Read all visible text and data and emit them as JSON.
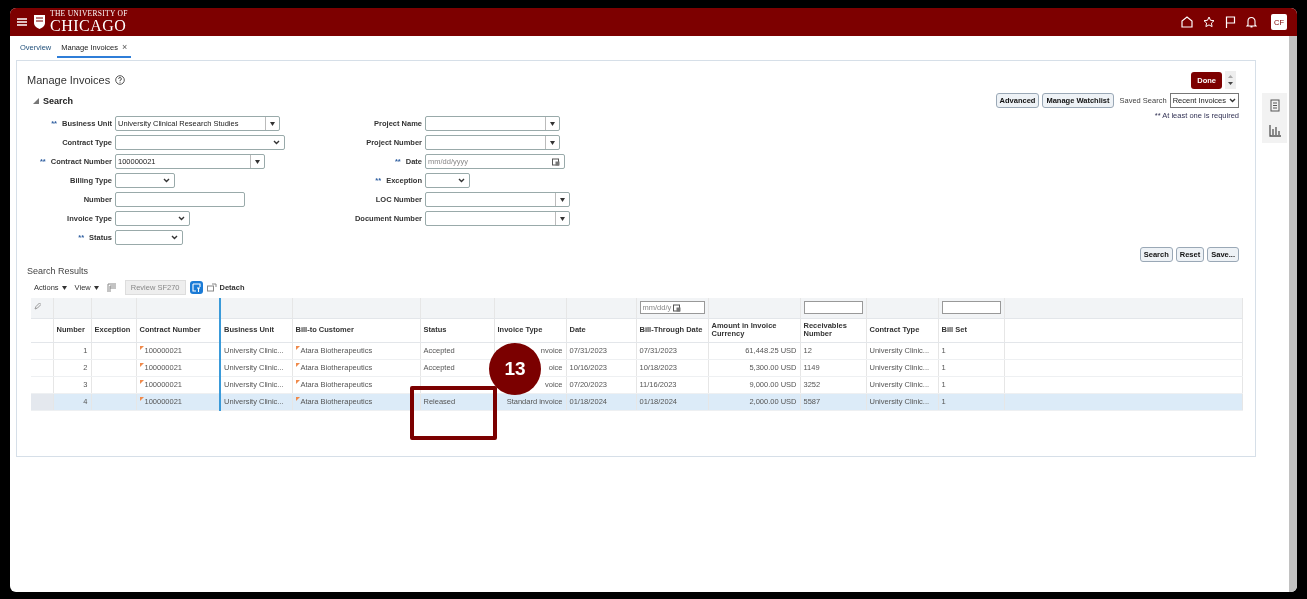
{
  "header": {
    "logo_line1": "THE UNIVERSITY OF",
    "logo_line2": "CHICAGO",
    "avatar": "CF"
  },
  "tabs": [
    {
      "label": "Overview",
      "selected": false
    },
    {
      "label": "Manage Invoices",
      "selected": true,
      "close": "×"
    }
  ],
  "page": {
    "title": "Manage Invoices",
    "done": "Done"
  },
  "search": {
    "title": "Search",
    "expanded": true,
    "buttons": [
      "Advanced",
      "Manage Watchlist"
    ],
    "saved_search_label": "Saved Search",
    "saved_search_value": "Recent Invoices",
    "note": "** At least one is required",
    "fields_left": [
      {
        "label": "Business Unit",
        "marker": "**",
        "kind": "combo",
        "value": "University Clinical Research Studies"
      },
      {
        "label": "Contract Type",
        "kind": "select"
      },
      {
        "label": "Contract Number",
        "marker": "**",
        "kind": "combo",
        "value": "100000021"
      },
      {
        "label": "Billing Type",
        "kind": "select"
      },
      {
        "label": "Number",
        "kind": "text"
      },
      {
        "label": "Invoice Type",
        "kind": "select"
      },
      {
        "label": "Status",
        "marker": "**",
        "kind": "select"
      }
    ],
    "fields_right": [
      {
        "label": "Project Name",
        "kind": "combo"
      },
      {
        "label": "Project Number",
        "kind": "combo"
      },
      {
        "label": "Date",
        "marker": "**",
        "kind": "date",
        "placeholder": "mm/dd/yyyy"
      },
      {
        "label": "Exception",
        "marker": "**",
        "kind": "select"
      },
      {
        "label": "LOC Number",
        "kind": "combo"
      },
      {
        "label": "Document Number",
        "kind": "combo"
      }
    ],
    "actions": [
      "Search",
      "Reset",
      "Save..."
    ]
  },
  "results": {
    "title": "Search Results",
    "menus": [
      "Actions",
      "View"
    ],
    "review_button": "Review SF270",
    "detach": "Detach",
    "columns": [
      {
        "label": "Number",
        "right_aligned": true
      },
      {
        "label": "Exception"
      },
      {
        "label": "Contract Number",
        "flag": true
      },
      {
        "label": "Business Unit"
      },
      {
        "label": "Bill-to Customer",
        "flag": true
      },
      {
        "label": "Status"
      },
      {
        "label": "Invoice Type",
        "right_aligned": true
      },
      {
        "label": "Date"
      },
      {
        "label": "Bill-Through Date",
        "filter": {
          "kind": "date",
          "placeholder": "mm/dd/y"
        }
      },
      {
        "label": "Amount in Invoice Currency",
        "right_aligned": true
      },
      {
        "label": "Receivables Number",
        "filter": {
          "kind": "text"
        }
      },
      {
        "label": "Contract Type"
      },
      {
        "label": "Bill Set",
        "filter": {
          "kind": "text"
        }
      }
    ],
    "rows": [
      {
        "selected": false,
        "cells": [
          "1",
          "",
          "100000021",
          "University Clinic...",
          "Atara Biotherapeutics",
          "Accepted",
          "nvoice",
          "07/31/2023",
          "07/31/2023",
          "61,448.25 USD",
          "12",
          "University Clinic...",
          "1"
        ]
      },
      {
        "selected": false,
        "cells": [
          "2",
          "",
          "100000021",
          "University Clinic...",
          "Atara Biotherapeutics",
          "Accepted",
          "oice",
          "10/16/2023",
          "10/18/2023",
          "5,300.00 USD",
          "1149",
          "University Clinic...",
          "1"
        ]
      },
      {
        "selected": false,
        "cells": [
          "3",
          "",
          "100000021",
          "University Clinic...",
          "Atara Biotherapeutics",
          "",
          "voice",
          "07/20/2023",
          "11/16/2023",
          "9,000.00 USD",
          "3252",
          "University Clinic...",
          "1"
        ]
      },
      {
        "selected": true,
        "cells": [
          "4",
          "",
          "100000021",
          "University Clinic...",
          "Atara Biotherapeutics",
          "Released",
          "Standard invoice",
          "01/18/2024",
          "01/18/2024",
          "2,000.00 USD",
          "5587",
          "University Clinic...",
          "1"
        ]
      }
    ]
  },
  "annotation": {
    "number": "13"
  }
}
